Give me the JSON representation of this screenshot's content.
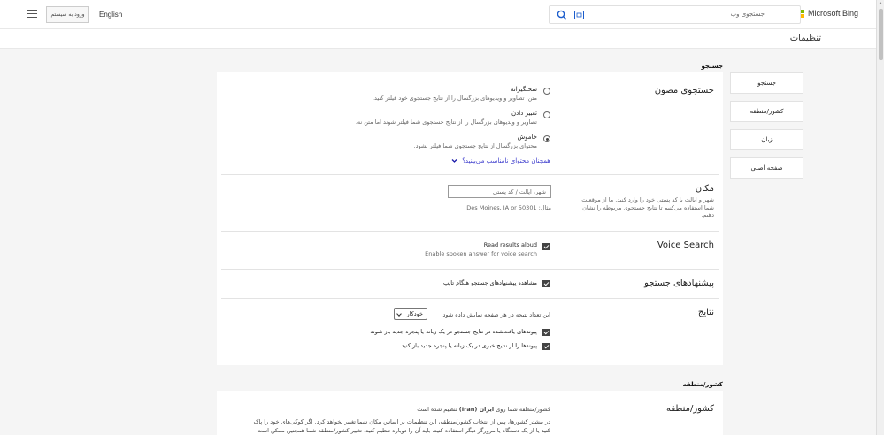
{
  "header": {
    "logo_text": "Microsoft Bing",
    "search_placeholder": "جستجوی وب",
    "language_link": "English",
    "login_button": "ورود به سیستم"
  },
  "colors": {
    "ms_red": "#f25022",
    "ms_green": "#7fba00",
    "ms_blue": "#00a4ef",
    "ms_yellow": "#ffb900",
    "search_icon": "#1a5ccc",
    "link": "#3a3acc"
  },
  "page_title": "تنظیمات",
  "nav": {
    "items": [
      "جستجو",
      "کشور/منطقه",
      "زبان",
      "صفحه اصلی"
    ]
  },
  "search_section": {
    "heading": "جستجو",
    "safe_search": {
      "title": "جستجوی مصون",
      "options": [
        {
          "label": "سختگیرانه",
          "desc": "متن، تصاویر و ویدیوهای بزرگسال را از نتایج جستجوی خود فیلتر کنید.",
          "checked": false
        },
        {
          "label": "تعبیر دادن",
          "desc": "تصاویر و ویدیوهای بزرگسال را از نتایج جستجوی شما فیلتر شوند اما متن نه.",
          "checked": false
        },
        {
          "label": "خاموش",
          "desc": "محتوای بزرگسال از نتایج جستجوی شما فیلتر نشود.",
          "checked": true
        }
      ],
      "inappropriate_link": "همچنان محتوای نامناسب می‌بینید؟"
    },
    "location": {
      "title": "مکان",
      "desc": "شهر و ایالت یا کد پستی خود را وارد کنید. ما از موقعیت شما استفاده می‌کنیم تا نتایج جستجوی مربوطه را نشان دهیم.",
      "input_placeholder": "شهر، ایالت / کد پستی",
      "example": "مثال: Des Moines, IA or 50301"
    },
    "voice_search": {
      "title": "Voice Search",
      "option_label": "Read results aloud",
      "option_desc": "Enable spoken answer for voice search"
    },
    "suggestions": {
      "title": "پیشنهادهای جستجو",
      "option_label": "مشاهده پیشنهادهای جستجو هنگام تایپ"
    },
    "results": {
      "title": "نتایج",
      "per_page_label": "این تعداد نتیجه در هر صفحه نمایش داده شود",
      "per_page_value": "خودکار",
      "open_links_label": "پیوندهای یافت‌شده در نتایج جستجو در یک زبانه یا پنجره جدید باز شوند",
      "open_news_label": "پیوندها را از نتایج خبری در یک زبانه یا پنجره جدید باز کنید"
    }
  },
  "country_section": {
    "heading": "کشور/منطقه",
    "title": "کشور/منطقه",
    "current_prefix": "کشور/منطقه شما روی",
    "current_value": "ایران (Iran)",
    "current_suffix": "تنظیم شده است",
    "desc_line1": "در بیشتر کشورها، پس از انتخاب کشور/منطقه، این تنظیمات بر اساس مکان شما تغییر نخواهد کرد. اگر کوکی‌های خود را پاک",
    "desc_line2": "کنید یا از یک دستگاه یا مرورگر دیگر استفاده کنید، باید آن را دوباره تنظیم کنید. تغییر کشور/منطقه شما همچنین ممکن است"
  }
}
